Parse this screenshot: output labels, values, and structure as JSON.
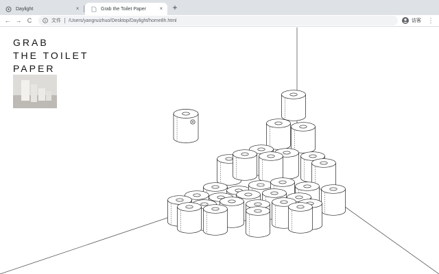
{
  "browser": {
    "tabs": [
      {
        "label": "Daylight",
        "active": false
      },
      {
        "label": "Grab the Toilet Paper",
        "active": true
      }
    ],
    "new_tab_label": "+",
    "close_glyph": "×",
    "nav": {
      "back": "←",
      "forward": "→",
      "reload": "C"
    },
    "address": {
      "security_label": "文件",
      "url": "/Users/yangruizhuo/Desktop/Daylight/home8h.html"
    },
    "profile_label": "访客",
    "menu_glyph": "⋮"
  },
  "page": {
    "title": "GRAB\nTHE TOILET\nPAPER",
    "accent": "#111111"
  }
}
